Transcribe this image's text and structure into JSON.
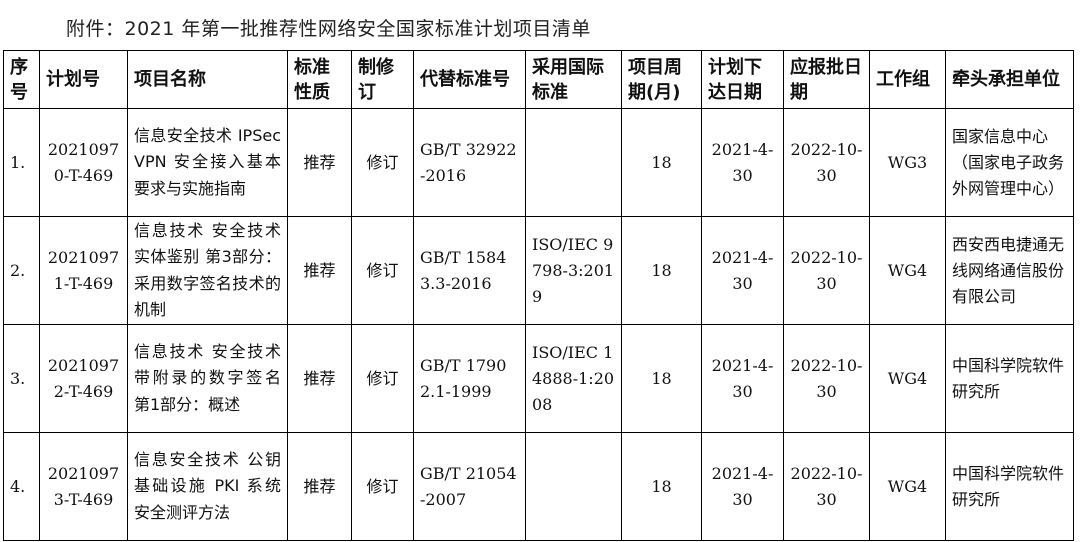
{
  "title": "附件：2021 年第一批推荐性网络安全国家标准计划项目清单",
  "headers": [
    "序号",
    "计划号",
    "项目名称",
    "标准性质",
    "制修订",
    "代替标准号",
    "采用国际标准",
    "项目周期(月)",
    "计划下达日期",
    "应报批日期",
    "工作组",
    "牵头承担单位"
  ],
  "rows": [
    {
      "no": "1.",
      "plan": "20210970-T-469",
      "name": "信息安全技术 IPSec VPN 安全接入基本要求与实施指南",
      "nature": "推荐",
      "revise": "修订",
      "replace": "GB/T 32922-2016",
      "intl": "",
      "period": "18",
      "issued": "2021-4-30",
      "due": "2022-10-30",
      "wg": "WG3",
      "org": "国家信息中心（国家电子政务外网管理中心）"
    },
    {
      "no": "2.",
      "plan": "20210971-T-469",
      "name": "信息技术 安全技术 实体鉴别 第3部分：采用数字签名技术的机制",
      "nature": "推荐",
      "revise": "修订",
      "replace": "GB/T 15843.3-2016",
      "intl": "ISO/IEC 9798-3:2019",
      "period": "18",
      "issued": "2021-4-30",
      "due": "2022-10-30",
      "wg": "WG4",
      "org": "西安西电捷通无线网络通信股份有限公司"
    },
    {
      "no": "3.",
      "plan": "20210972-T-469",
      "name": "信息技术 安全技术 带附录的数字签名 第1部分：概述",
      "nature": "推荐",
      "revise": "修订",
      "replace": "GB/T 17902.1-1999",
      "intl": "ISO/IEC 14888-1:2008",
      "period": "18",
      "issued": "2021-4-30",
      "due": "2022-10-30",
      "wg": "WG4",
      "org": "中国科学院软件研究所"
    },
    {
      "no": "4.",
      "plan": "20210973-T-469",
      "name": "信息安全技术 公钥基础设施 PKI 系统安全测评方法",
      "nature": "推荐",
      "revise": "修订",
      "replace": "GB/T 21054-2007",
      "intl": "",
      "period": "18",
      "issued": "2021-4-30",
      "due": "2022-10-30",
      "wg": "WG4",
      "org": "中国科学院软件研究所"
    }
  ]
}
